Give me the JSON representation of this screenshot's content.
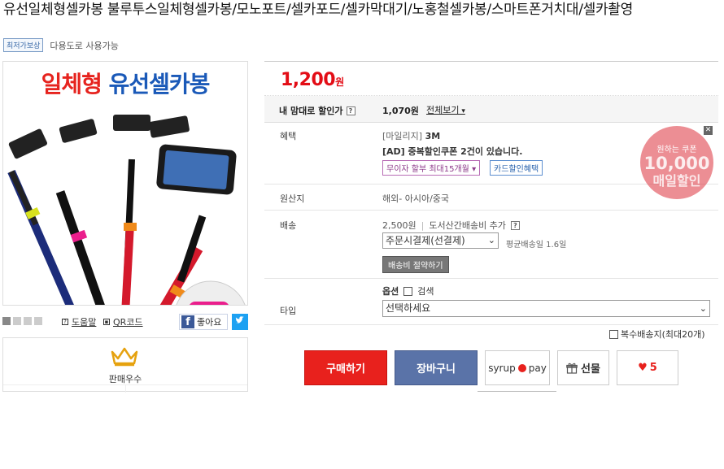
{
  "product": {
    "title": "유선일체형셀카봉 불루투스일체형셀카봉/모노포트/셀카포드/셀카막대기/노홍철셀카봉/스마트폰거치대/셀카촬영",
    "badge": "최저가보상",
    "usage": "다용도로 사용가능",
    "image_text_red": "일체형",
    "image_text_blue": "유선셀카봉"
  },
  "image_tools": {
    "help": "도움말",
    "qr": "QR코드",
    "like": "좋아요"
  },
  "seller": {
    "label": "판매우수"
  },
  "price": {
    "value": "1,200",
    "unit": "원"
  },
  "my_price": {
    "label": "내 맘대로 할인가",
    "value": "1,070원",
    "view_all": "전체보기"
  },
  "benefit": {
    "label": "혜택",
    "mileage_prefix": "[마일리지]",
    "mileage_value": "3M",
    "ad": "[AD] 중복할인쿠폰 2건이 있습니다.",
    "installment": "무이자 할부 최대15개월",
    "card": "카드할인혜택",
    "coupon_line1": "원하는 쿠폰",
    "coupon_line2": "10,000",
    "coupon_line3": "매일할인"
  },
  "origin": {
    "label": "원산지",
    "value": "해외- 아시아/중국"
  },
  "shipping": {
    "label": "배송",
    "fee": "2,500원",
    "island": "도서산간배송비 추가",
    "method": "주문시결제(선결제)",
    "avg": "평균배송일 1.6일",
    "save": "배송비 절약하기"
  },
  "type": {
    "label": "타입",
    "option": "옵션",
    "search": "검색",
    "select": "선택하세요"
  },
  "multi_ship": "복수배송지(최대20개)",
  "actions": {
    "buy": "구매하기",
    "cart": "장바구니",
    "syrup": "syrup",
    "pay": "pay",
    "gift": "선물",
    "likes": "5"
  }
}
